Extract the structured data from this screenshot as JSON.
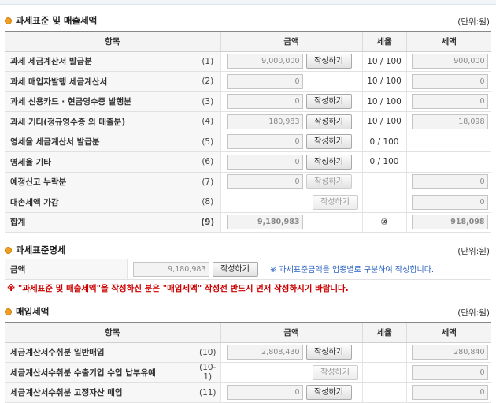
{
  "sections": {
    "sales": {
      "title": "과세표준 및 매출세액",
      "unit": "(단위:원)"
    },
    "base": {
      "title": "과세표준명세",
      "unit": "(단위:원)"
    },
    "purchase": {
      "title": "매입세액",
      "unit": "(단위:원)"
    }
  },
  "table_headers": {
    "item": "항목",
    "amount": "금액",
    "rate": "세율",
    "tax": "세액"
  },
  "write_label": "작성하기",
  "sales_rows": [
    {
      "label": "과세 세금계산서 발급분",
      "no": "(1)",
      "amount": "9,000,000",
      "button": "active",
      "rate": "10 / 100",
      "tax": "900,000"
    },
    {
      "label": "과세 매입자발행 세금계산서",
      "no": "(2)",
      "amount": "0",
      "button": "none",
      "rate": "10 / 100",
      "tax": "0"
    },
    {
      "label": "과세 신용카드 · 현금영수증 발행분",
      "no": "(3)",
      "amount": "0",
      "button": "active",
      "rate": "10 / 100",
      "tax": "0"
    },
    {
      "label": "과세 기타(정규영수증 외 매출분)",
      "no": "(4)",
      "amount": "180,983",
      "button": "active",
      "rate": "10 / 100",
      "tax": "18,098"
    },
    {
      "label": "영세율 세금계산서 발급분",
      "no": "(5)",
      "amount": "0",
      "button": "active",
      "rate": "0 / 100",
      "tax": ""
    },
    {
      "label": "영세율 기타",
      "no": "(6)",
      "amount": "0",
      "button": "active",
      "rate": "0 / 100",
      "tax": ""
    },
    {
      "label": "예정신고 누락분",
      "no": "(7)",
      "amount": "0",
      "button": "disabled",
      "rate": "",
      "tax": "0"
    },
    {
      "label": "대손세액 가감",
      "no": "(8)",
      "amount": "",
      "button": "disabled-only",
      "rate": "",
      "tax": "0"
    }
  ],
  "sales_total": {
    "label": "합계",
    "no": "(9)",
    "amount": "9,180,983",
    "rate": "⑩",
    "tax": "918,098"
  },
  "base_row": {
    "label": "금액",
    "amount": "9,180,983",
    "note": "※ 과세표준금액을 업종별로 구분하여 작성합니다."
  },
  "warning": "※ \"과세표준 및 매출세액\"을 작성하신 분은 \"매입세액\" 작성전 반드시 먼저 작성하시기 바랍니다.",
  "purchase_rows": [
    {
      "label": "세금계산서수취분 일반매입",
      "no": "(10)",
      "amount": "2,808,430",
      "button": "active",
      "rate": "",
      "tax": "280,840"
    },
    {
      "label": "세금계산서수취분 수출기업 수입 납부유예",
      "no": "(10-1)",
      "amount": "",
      "button": "disabled-only",
      "rate": "",
      "tax": "0"
    },
    {
      "label": "세금계산서수취분 고정자산 매입",
      "no": "(11)",
      "amount": "0",
      "button": "active",
      "rate": "",
      "tax": "0"
    }
  ]
}
